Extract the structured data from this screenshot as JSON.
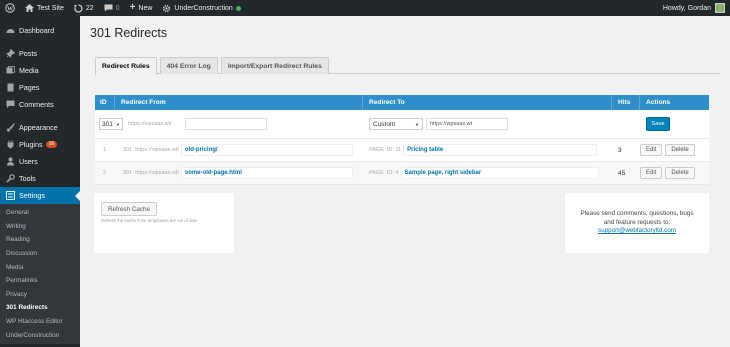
{
  "admin_bar": {
    "site_name": "Test Site",
    "updates_count": "22",
    "comments_count": "0",
    "new_label": "New",
    "plugin_name": "UnderConstruction",
    "greeting": "Howdy, Gordan"
  },
  "sidebar": {
    "items": [
      {
        "label": "Dashboard",
        "icon": "dashboard-icon"
      },
      {
        "label": "Posts",
        "icon": "pin-icon"
      },
      {
        "label": "Media",
        "icon": "media-icon"
      },
      {
        "label": "Pages",
        "icon": "pages-icon"
      },
      {
        "label": "Comments",
        "icon": "comments-icon"
      },
      {
        "label": "Appearance",
        "icon": "brush-icon"
      },
      {
        "label": "Plugins",
        "icon": "plugin-icon",
        "badge": "16"
      },
      {
        "label": "Users",
        "icon": "users-icon"
      },
      {
        "label": "Tools",
        "icon": "wrench-icon"
      },
      {
        "label": "Settings",
        "icon": "settings-icon"
      }
    ],
    "submenu": [
      "General",
      "Writing",
      "Reading",
      "Discussion",
      "Media",
      "Permalinks",
      "Privacy",
      "301 Redirects",
      "WP Htaccess Editor",
      "UnderConstruction"
    ]
  },
  "page": {
    "title": "301 Redirects",
    "tabs": [
      "Redirect Rules",
      "404 Error Log",
      "Import/Export Redirect Rules"
    ]
  },
  "table": {
    "headers": {
      "id": "ID",
      "from": "Redirect From",
      "to": "Redirect To",
      "hits": "Hits",
      "actions": "Actions"
    },
    "add_row": {
      "status": "301",
      "from_prefix": "https://wpsaas.wt/",
      "to_type": "Custom",
      "to_url": "https://wpsaas.wt",
      "save_label": "Save"
    },
    "rows": [
      {
        "id": "1",
        "status": "301",
        "prefix": "https://wpsaas.wt/",
        "from": "old-pricing/",
        "type": "PAGE",
        "type_id": "ID: 11",
        "to": "Pricing table",
        "hits": "3"
      },
      {
        "id": "2",
        "status": "301",
        "prefix": "https://wpsaas.wt/",
        "from": "some-old-page.html",
        "type": "PAGE",
        "type_id": "ID: 4",
        "to": "Sample page, right sidebar",
        "hits": "45"
      }
    ],
    "edit_label": "Edit",
    "delete_label": "Delete"
  },
  "cache": {
    "button": "Refresh Cache",
    "help": "Refresh the cache if the dropdowns are out of date"
  },
  "support": {
    "line1": "Please send comments, questions, bugs",
    "line2": "and feature requests to:",
    "email": "support@webfactoryltd.com"
  },
  "colors": {
    "admin_bar": "#23282d",
    "accent": "#0073aa",
    "table_header": "#2e8fca",
    "button_primary": "#0085ba",
    "plugin_badge": "#d54e21",
    "status_dot": "#46b450"
  }
}
